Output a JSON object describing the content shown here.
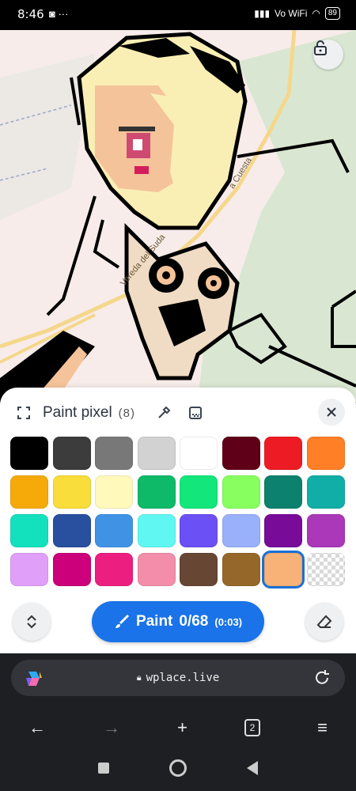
{
  "status_bar": {
    "time": "8:46",
    "battery": "89",
    "network": "Vo WiFi"
  },
  "map": {
    "road_label": "a Cuesta",
    "road_label_2": "Vereda del Suda"
  },
  "panel": {
    "title": "Paint pixel",
    "count": "(8)",
    "icons": [
      "expand-icon",
      "eyedropper-icon",
      "grid-icon",
      "close-icon"
    ],
    "palette": [
      "#000000",
      "#3c3c3c",
      "#787878",
      "#d2d2d2",
      "#ffffff",
      "#600018",
      "#ed1c24",
      "#ff7f27",
      "#f6aa09",
      "#f9dd3b",
      "#fffabc",
      "#0eb968",
      "#13e67b",
      "#87ff5e",
      "#0c816e",
      "#10aea6",
      "#13e1be",
      "#28509e",
      "#4093e4",
      "#60f7f2",
      "#6b50f6",
      "#99b1fb",
      "#780c99",
      "#aa38b9",
      "#e09ff9",
      "#cb007a",
      "#ec1f80",
      "#f38da9",
      "#684634",
      "#95682a",
      "#f8b277",
      "transparent"
    ],
    "selected_index": 30,
    "paint_button": {
      "label": "Paint",
      "count": "0/68",
      "timer": "(0:03)"
    }
  },
  "browser": {
    "url": "wplace.live",
    "tabs": "2"
  },
  "colors": {
    "accent": "#1a73e8",
    "panel_bg": "#ffffff",
    "map_bg": "#f7ece9"
  }
}
